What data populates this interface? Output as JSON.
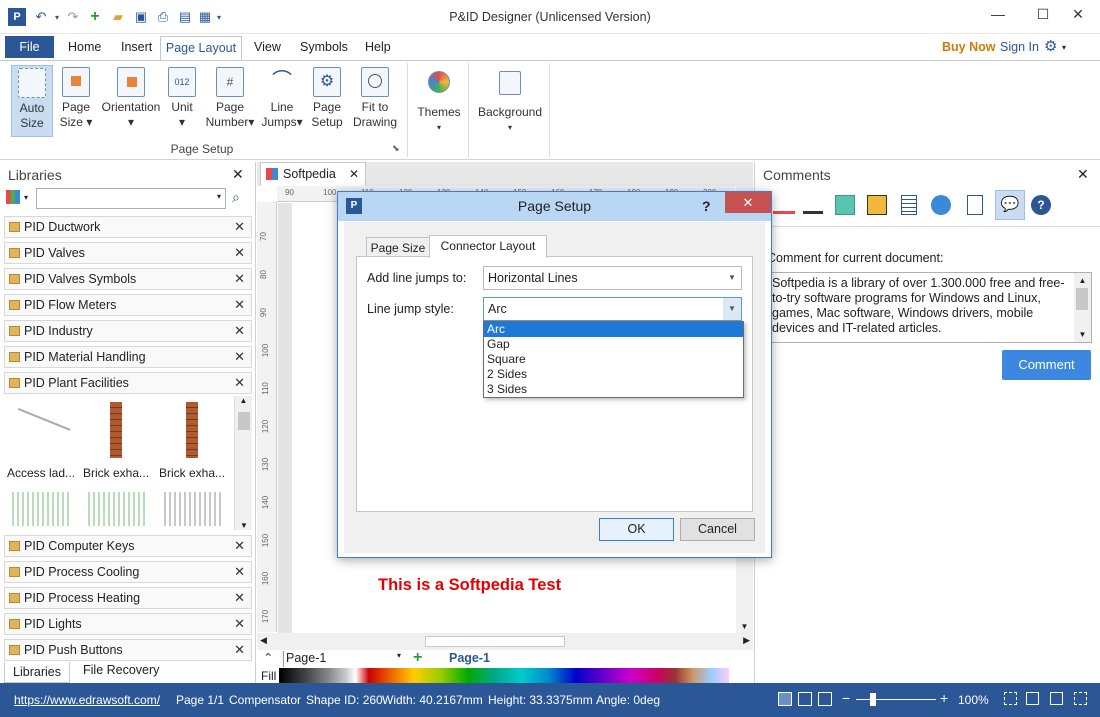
{
  "window": {
    "title": "P&ID Designer (Unlicensed Version)"
  },
  "menu": {
    "file": "File",
    "tabs": [
      "Home",
      "Insert",
      "Page Layout",
      "View",
      "Symbols",
      "Help"
    ],
    "buy_now": "Buy Now",
    "sign_in": "Sign In"
  },
  "ribbon": {
    "page_setup_group": "Page Setup",
    "buttons": [
      {
        "line1": "Auto",
        "line2": "Size"
      },
      {
        "line1": "Page",
        "line2": "Size ▾"
      },
      {
        "line1": "Orientation",
        "line2": "▾"
      },
      {
        "line1": "Unit",
        "line2": "▾"
      },
      {
        "line1": "Page",
        "line2": "Number▾"
      },
      {
        "line1": "Line",
        "line2": "Jumps▾"
      },
      {
        "line1": "Page",
        "line2": "Setup"
      },
      {
        "line1": "Fit to",
        "line2": "Drawing"
      }
    ],
    "themes": "Themes",
    "background": "Background"
  },
  "libraries": {
    "title": "Libraries",
    "items_top": [
      "PID Ductwork",
      "PID Valves",
      "PID Valves Symbols",
      "PID Flow Meters",
      "PID Industry",
      "PID Material Handling",
      "PID Plant Facilities"
    ],
    "shapes": [
      "Access lad...",
      "Brick exha...",
      "Brick exha..."
    ],
    "items_bottom": [
      "PID Computer Keys",
      "PID Process Cooling",
      "PID Process Heating",
      "PID Lights",
      "PID Push Buttons"
    ],
    "bottom_tabs": [
      "Libraries",
      "File Recovery"
    ]
  },
  "document": {
    "tab": "Softpedia",
    "ruler_top": [
      "90",
      "100",
      "110",
      "120",
      "130",
      "140",
      "150",
      "160",
      "170",
      "180",
      "190",
      "200"
    ],
    "ruler_left": [
      "70",
      "80",
      "90",
      "100",
      "110",
      "120",
      "130",
      "140",
      "150",
      "160",
      "170"
    ],
    "canvas_text": "This is a Softpedia Test",
    "page_selector": "Page-1",
    "page_tab": "Page-1",
    "fill_label": "Fill"
  },
  "comments": {
    "title": "Comments",
    "label": "Comment for current document:",
    "text": "Softpedia is a library of over 1.300.000 free and free-to-try software programs for Windows and Linux, games, Mac software, Windows drivers, mobile devices and IT-related articles.",
    "button": "Comment"
  },
  "dialog": {
    "title": "Page Setup",
    "help": "?",
    "tabs": [
      "Page Size",
      "Connector Layout"
    ],
    "line_jumps_label": "Add line jumps to:",
    "line_jumps_value": "Horizontal Lines",
    "style_label": "Line jump style:",
    "style_value": "Arc",
    "style_options": [
      "Arc",
      "Gap",
      "Square",
      "2 Sides",
      "3 Sides"
    ],
    "ok": "OK",
    "cancel": "Cancel"
  },
  "status": {
    "url": "https://www.edrawsoft.com/",
    "page": "Page 1/1",
    "shape": "Compensator",
    "shape_id": "Shape ID: 260",
    "width": "Width: 40.2167mm",
    "height": "Height: 33.3375mm",
    "angle": "Angle: 0deg",
    "zoom": "100%"
  },
  "colors": {
    "accent": "#2b5797",
    "buy_now": "#d4780a",
    "canvas_text": "#e60000",
    "dialog_title": "#b9d6f5"
  }
}
